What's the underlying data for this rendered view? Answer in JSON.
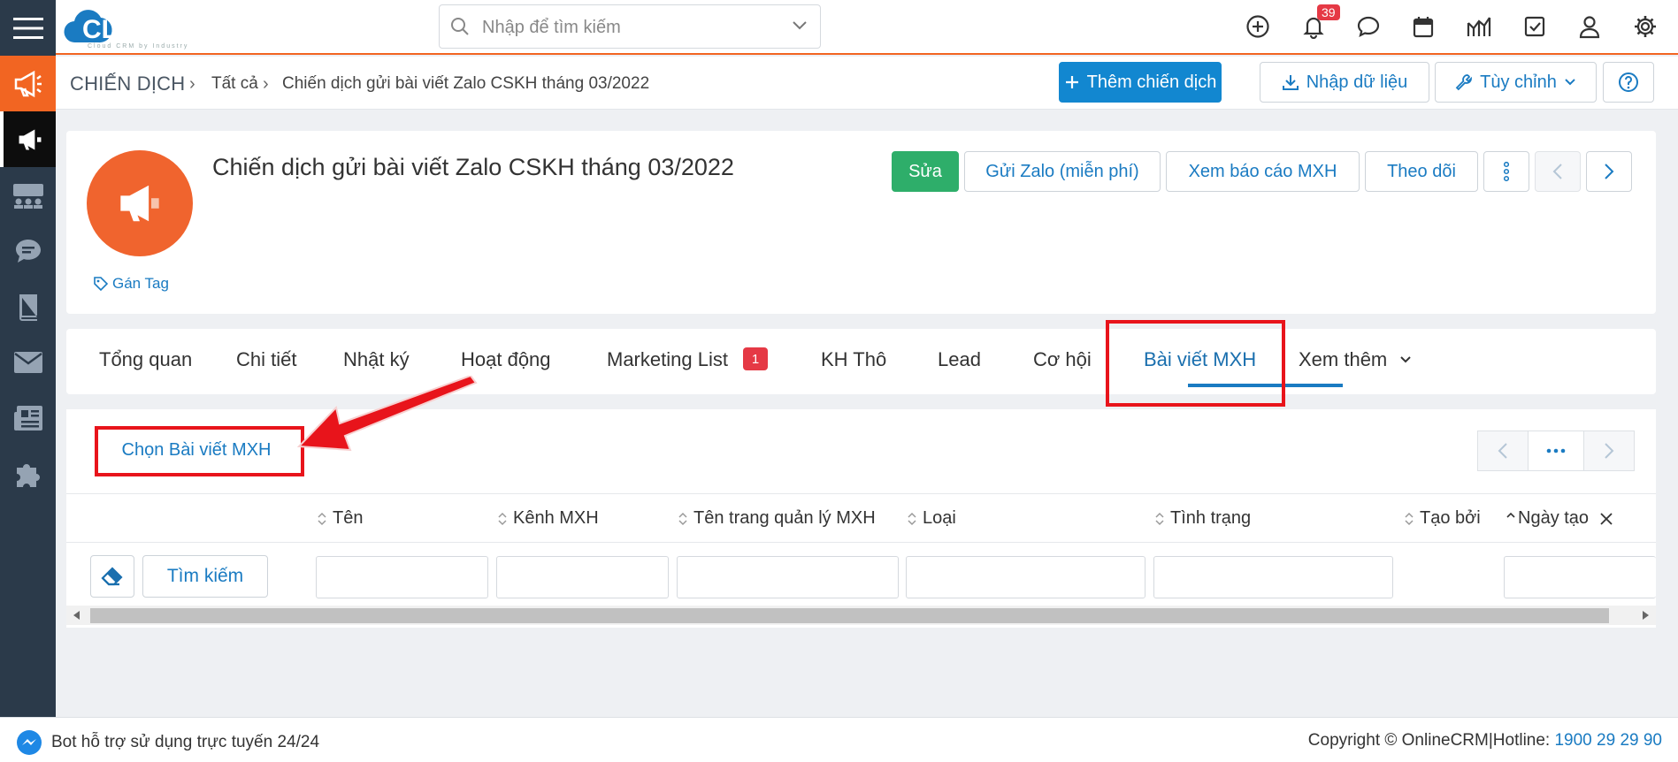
{
  "app": {
    "logo_text": "CLOUDPRO",
    "logo_tagline": "Cloud CRM by Industry"
  },
  "search": {
    "placeholder": "Nhập để tìm kiếm"
  },
  "header": {
    "notification_count": "39",
    "icons": [
      "plus-circle-icon",
      "bell-icon",
      "chat-icon",
      "calendar-icon",
      "chart-icon",
      "checkbox-icon",
      "user-icon",
      "gear-icon"
    ]
  },
  "breadcrumb": {
    "root": "CHIẾN DỊCH",
    "level1": "Tất cả",
    "current": "Chiến dịch gửi bài viết Zalo CSKH tháng 03/2022"
  },
  "toolbar": {
    "add_label": "Thêm chiến dịch",
    "import_label": "Nhập dữ liệu",
    "customize_label": "Tùy chỉnh"
  },
  "record": {
    "title": "Chiến dịch gửi bài viết Zalo CSKH tháng 03/2022",
    "tag_label": "Gán Tag",
    "actions": {
      "edit": "Sửa",
      "send_zalo": "Gửi Zalo (miễn phí)",
      "view_report": "Xem báo cáo MXH",
      "follow": "Theo dõi"
    }
  },
  "tabs": [
    {
      "label": "Tổng quan"
    },
    {
      "label": "Chi tiết"
    },
    {
      "label": "Nhật ký"
    },
    {
      "label": "Hoạt động"
    },
    {
      "label": "Marketing List",
      "badge": "1"
    },
    {
      "label": "KH Thô"
    },
    {
      "label": "Lead"
    },
    {
      "label": "Cơ hội"
    },
    {
      "label": "Bài viết MXH",
      "active": true
    },
    {
      "label": "Xem thêm"
    }
  ],
  "related": {
    "select_label": "Chọn Bài viết MXH",
    "search_button": "Tìm kiếm",
    "columns": [
      "Tên",
      "Kênh MXH",
      "Tên trang quản lý MXH",
      "Loại",
      "Tình trạng",
      "Tạo bởi",
      "Ngày tạo"
    ]
  },
  "footer": {
    "support_text": "Bot hỗ trợ sử dụng trực tuyến 24/24",
    "copyright": "Copyright © OnlineCRM|Hotline: ",
    "hotline": "1900 29 29 90"
  },
  "colors": {
    "accent": "#f26522",
    "primary": "#1287d0",
    "success": "#2eae6a",
    "sidebar": "#2b3a4a",
    "annotation": "#e8141b"
  }
}
